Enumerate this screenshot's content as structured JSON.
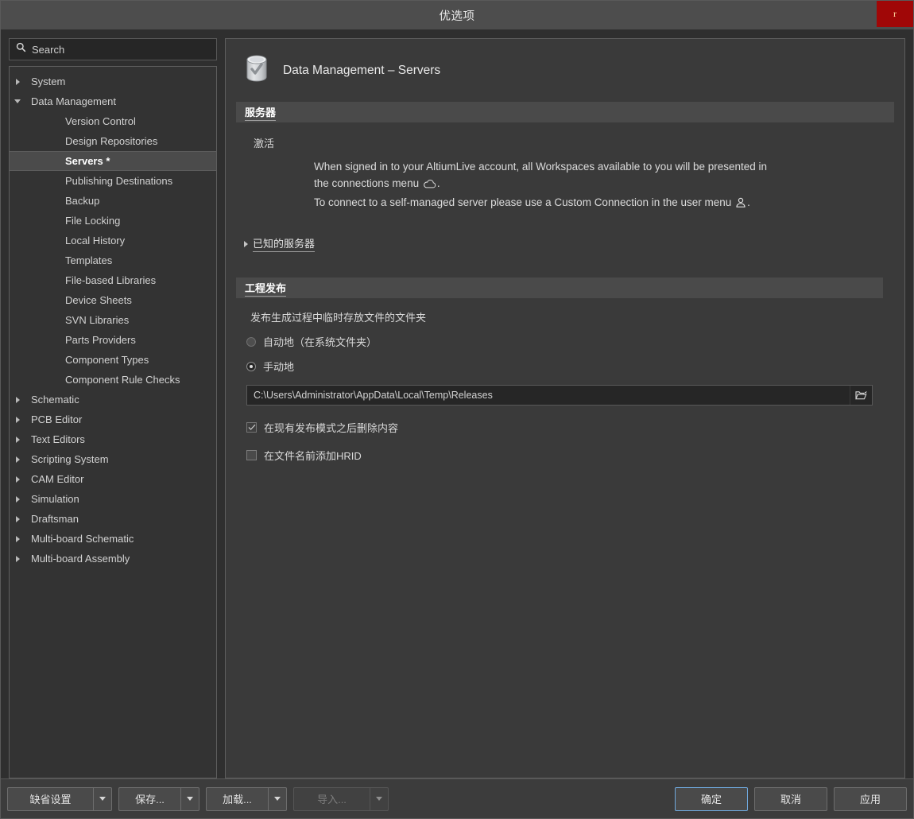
{
  "window": {
    "title": "优选项",
    "close_label": "r"
  },
  "sidebar": {
    "search": {
      "placeholder": "Search",
      "value": "",
      "icon": "search-icon"
    },
    "items": [
      {
        "label": "System",
        "level": 0,
        "expanded": false,
        "selected": false
      },
      {
        "label": "Data Management",
        "level": 0,
        "expanded": true,
        "selected": false
      },
      {
        "label": "Version Control",
        "level": 1,
        "expanded": false,
        "selected": false
      },
      {
        "label": "Design Repositories",
        "level": 1,
        "expanded": false,
        "selected": false
      },
      {
        "label": "Servers *",
        "level": 1,
        "expanded": false,
        "selected": true
      },
      {
        "label": "Publishing Destinations",
        "level": 1,
        "expanded": false,
        "selected": false
      },
      {
        "label": "Backup",
        "level": 1,
        "expanded": false,
        "selected": false
      },
      {
        "label": "File Locking",
        "level": 1,
        "expanded": false,
        "selected": false
      },
      {
        "label": "Local History",
        "level": 1,
        "expanded": false,
        "selected": false
      },
      {
        "label": "Templates",
        "level": 1,
        "expanded": false,
        "selected": false
      },
      {
        "label": "File-based Libraries",
        "level": 1,
        "expanded": false,
        "selected": false
      },
      {
        "label": "Device Sheets",
        "level": 1,
        "expanded": false,
        "selected": false
      },
      {
        "label": "SVN Libraries",
        "level": 1,
        "expanded": false,
        "selected": false
      },
      {
        "label": "Parts Providers",
        "level": 1,
        "expanded": false,
        "selected": false
      },
      {
        "label": "Component Types",
        "level": 1,
        "expanded": false,
        "selected": false
      },
      {
        "label": "Component Rule Checks",
        "level": 1,
        "expanded": false,
        "selected": false
      },
      {
        "label": "Schematic",
        "level": 0,
        "expanded": false,
        "selected": false
      },
      {
        "label": "PCB Editor",
        "level": 0,
        "expanded": false,
        "selected": false
      },
      {
        "label": "Text Editors",
        "level": 0,
        "expanded": false,
        "selected": false
      },
      {
        "label": "Scripting System",
        "level": 0,
        "expanded": false,
        "selected": false
      },
      {
        "label": "CAM Editor",
        "level": 0,
        "expanded": false,
        "selected": false
      },
      {
        "label": "Simulation",
        "level": 0,
        "expanded": false,
        "selected": false
      },
      {
        "label": "Draftsman",
        "level": 0,
        "expanded": false,
        "selected": false
      },
      {
        "label": "Multi-board Schematic",
        "level": 0,
        "expanded": false,
        "selected": false
      },
      {
        "label": "Multi-board Assembly",
        "level": 0,
        "expanded": false,
        "selected": false
      }
    ]
  },
  "main": {
    "page_title": "Data Management – Servers",
    "page_icon": "database-check-icon",
    "servers_section": {
      "title": "服务器",
      "activate_label": "激活",
      "description_line1": "When signed in to your AltiumLive account, all Workspaces available to you will be presented in",
      "description_line2_pre": "the connections menu",
      "description_line2_post": ".",
      "description_line3_pre": "To connect to a self-managed server please use a Custom Connection in the user menu",
      "description_line3_post": ".",
      "cloud_icon": "cloud-icon",
      "user_icon": "user-icon",
      "known_servers_label": "已知的服务器",
      "known_servers_expanded": false
    },
    "releases_section": {
      "title": "工程发布",
      "folder_label": "发布生成过程中临时存放文件的文件夹",
      "radio_auto_label": "自动地（在系统文件夹）",
      "radio_auto_checked": false,
      "radio_manual_label": "手动地",
      "radio_manual_checked": true,
      "path_value": "C:\\Users\\Administrator\\AppData\\Local\\Temp\\Releases",
      "browse_icon": "folder-open-icon",
      "check_delete_label": "在现有发布模式之后删除内容",
      "check_delete_checked": true,
      "check_hrid_label": "在文件名前添加HRID",
      "check_hrid_checked": false
    }
  },
  "footer": {
    "left_buttons": [
      {
        "label": "缺省设置",
        "disabled": false
      },
      {
        "label": "保存...",
        "disabled": false
      },
      {
        "label": "加载...",
        "disabled": false
      },
      {
        "label": "导入...",
        "disabled": true
      }
    ],
    "ok_label": "确定",
    "cancel_label": "取消",
    "apply_label": "应用"
  },
  "colors": {
    "close_red": "#a00707",
    "focus_blue": "#6fa8dc",
    "panel_bg": "#3a3a3a",
    "tree_bg": "#333333",
    "titlebar_bg": "#4d4d4d"
  }
}
